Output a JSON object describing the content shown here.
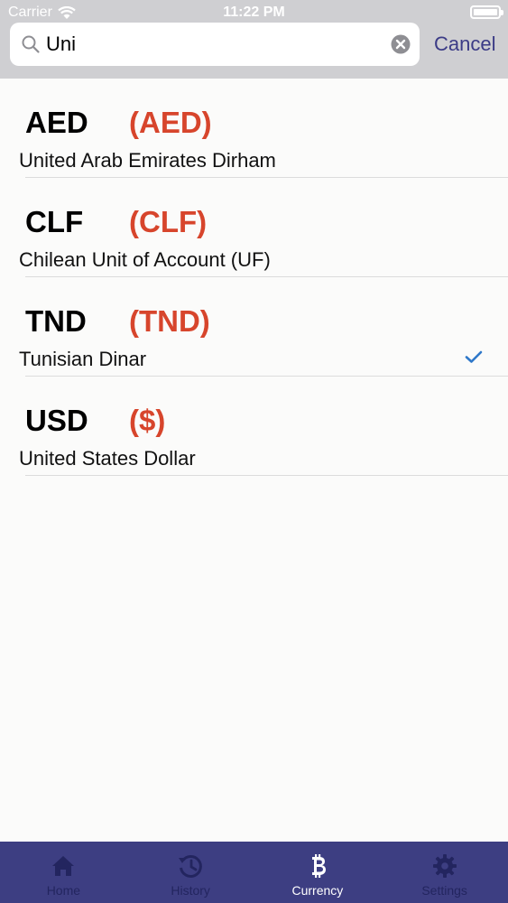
{
  "status_bar": {
    "carrier": "Carrier",
    "time": "11:22 PM"
  },
  "search": {
    "value": "Uni",
    "cancel_label": "Cancel"
  },
  "currencies": [
    {
      "code": "AED",
      "symbol": "(AED)",
      "name": "United Arab Emirates Dirham",
      "selected": false
    },
    {
      "code": "CLF",
      "symbol": "(CLF)",
      "name": "Chilean Unit of Account (UF)",
      "selected": false
    },
    {
      "code": "TND",
      "symbol": "(TND)",
      "name": "Tunisian Dinar",
      "selected": false
    },
    {
      "code": "USD",
      "symbol": "($)",
      "name": "United States Dollar",
      "selected": true
    }
  ],
  "tabs": [
    {
      "label": "Home",
      "icon": "home-icon",
      "active": false
    },
    {
      "label": "History",
      "icon": "history-icon",
      "active": false
    },
    {
      "label": "Currency",
      "icon": "bitcoin-icon",
      "active": true
    },
    {
      "label": "Settings",
      "icon": "gear-icon",
      "active": false
    }
  ],
  "colors": {
    "accent": "#d7452c",
    "tabbar": "#3d3e82",
    "cancel": "#3b3b86",
    "check": "#2f78c9"
  }
}
